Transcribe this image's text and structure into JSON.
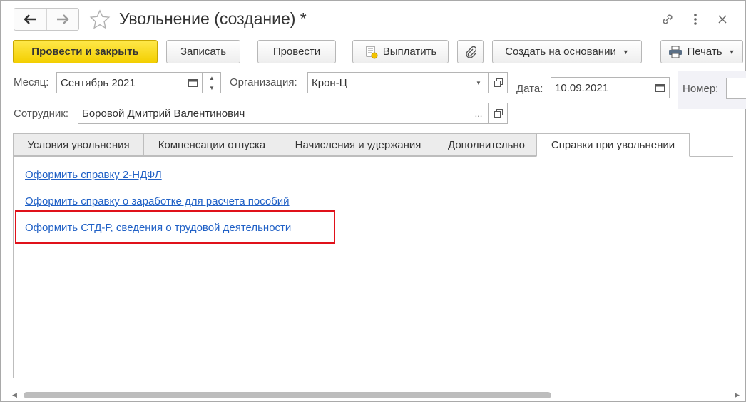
{
  "window": {
    "title": "Увольнение (создание) *",
    "icons": [
      "back-arrow-icon",
      "forward-arrow-icon",
      "star-icon",
      "link-icon",
      "more-icon",
      "close-icon"
    ]
  },
  "toolbar": {
    "post_close": "Провести и закрыть",
    "save": "Записать",
    "post": "Провести",
    "pay": "Выплатить",
    "create_based": "Создать на основании",
    "print": "Печать"
  },
  "fields": {
    "month_label": "Месяц:",
    "month_value": "Сентябрь 2021",
    "org_label": "Организация:",
    "org_value": "Крон-Ц",
    "date_label": "Дата:",
    "date_value": "10.09.2021",
    "number_label": "Номер:",
    "employee_label": "Сотрудник:",
    "employee_value": "Боровой Дмитрий Валентинович",
    "select_button": "..."
  },
  "tabs": [
    {
      "label": "Условия увольнения",
      "active": false
    },
    {
      "label": "Компенсации отпуска",
      "active": false
    },
    {
      "label": "Начисления и удержания",
      "active": false
    },
    {
      "label": "Дополнительно",
      "active": false
    },
    {
      "label": "Справки при увольнении",
      "active": true
    }
  ],
  "links": [
    {
      "label": "Оформить справку 2-НДФЛ"
    },
    {
      "label": "Оформить справку о заработке для расчета пособий"
    },
    {
      "label": "Оформить СТД-Р, сведения о трудовой деятельности"
    }
  ],
  "colors": {
    "primary_button": "#f3cf00",
    "link": "#2161c6",
    "highlight_box": "#e0111a"
  }
}
